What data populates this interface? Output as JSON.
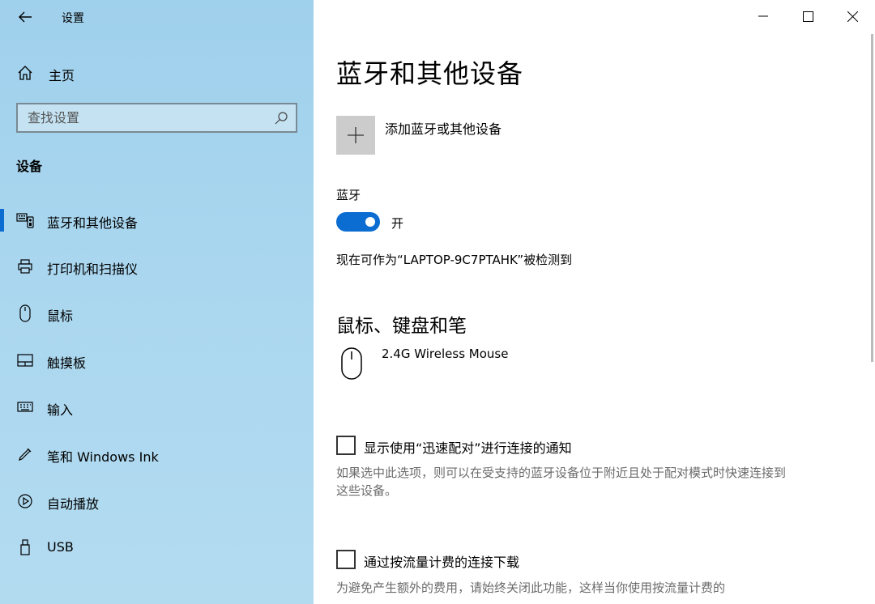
{
  "app": {
    "title": "设置"
  },
  "sidebar": {
    "home_label": "主页",
    "search_placeholder": "查找设置",
    "section_title": "设备",
    "items": [
      {
        "label": "蓝牙和其他设备",
        "icon": "bluetooth-devices-icon",
        "active": true
      },
      {
        "label": "打印机和扫描仪",
        "icon": "printer-icon"
      },
      {
        "label": "鼠标",
        "icon": "mouse-icon"
      },
      {
        "label": "触摸板",
        "icon": "touchpad-icon"
      },
      {
        "label": "输入",
        "icon": "keyboard-icon"
      },
      {
        "label": "笔和 Windows Ink",
        "icon": "pen-icon"
      },
      {
        "label": "自动播放",
        "icon": "autoplay-icon"
      },
      {
        "label": "USB",
        "icon": "usb-icon"
      }
    ]
  },
  "main": {
    "title": "蓝牙和其他设备",
    "add_device_label": "添加蓝牙或其他设备",
    "bluetooth": {
      "label": "蓝牙",
      "state": "开",
      "on": true,
      "discoverable_text": "现在可作为“LAPTOP-9C7PTAHK”被检测到"
    },
    "mouse_section": {
      "title": "鼠标、键盘和笔",
      "devices": [
        {
          "name": "2.4G Wireless Mouse",
          "icon": "mouse-icon"
        }
      ]
    },
    "swift_pair": {
      "label": "显示使用“迅速配对”进行连接的通知",
      "checked": false,
      "description": "如果选中此选项，则可以在受支持的蓝牙设备位于附近且处于配对模式时快速连接到这些设备。"
    },
    "metered": {
      "label": "通过按流量计费的连接下载",
      "checked": false,
      "description": "为避免产生额外的费用，请始终关闭此功能，这样当你使用按流量计费的"
    }
  },
  "colors": {
    "accent": "#0b6cd2",
    "sidebar_bg": "#a9d6ef"
  }
}
